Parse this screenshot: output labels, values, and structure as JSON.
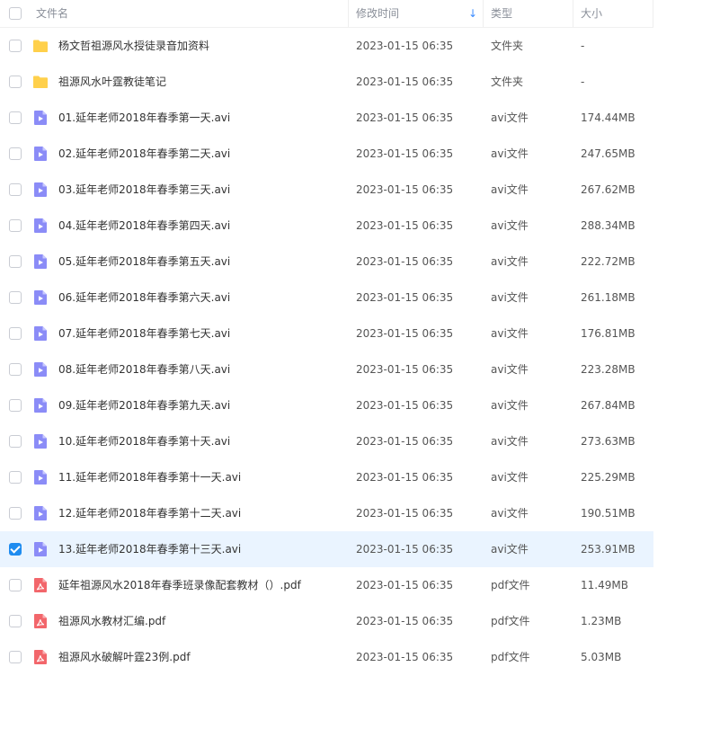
{
  "header": {
    "name_label": "文件名",
    "modified_label": "修改时间",
    "type_label": "类型",
    "size_label": "大小",
    "sort_icon": "sort-down-arrow-icon",
    "sort_glyph": "↓"
  },
  "colors": {
    "folder": "#ffd04b",
    "video": "#8b8cf7",
    "pdf": "#f2666b",
    "checkbox_checked": "#1f8cf0",
    "selected_row": "#eaf4ff"
  },
  "rows": [
    {
      "name": "杨文哲祖源风水授徒录音加资料",
      "modified": "2023-01-15 06:35",
      "type": "文件夹",
      "size": "-",
      "icon": "folder",
      "checked": false
    },
    {
      "name": "祖源风水叶霆教徒笔记",
      "modified": "2023-01-15 06:35",
      "type": "文件夹",
      "size": "-",
      "icon": "folder",
      "checked": false
    },
    {
      "name": "01.延年老师2018年春季第一天.avi",
      "modified": "2023-01-15 06:35",
      "type": "avi文件",
      "size": "174.44MB",
      "icon": "video",
      "checked": false
    },
    {
      "name": "02.延年老师2018年春季第二天.avi",
      "modified": "2023-01-15 06:35",
      "type": "avi文件",
      "size": "247.65MB",
      "icon": "video",
      "checked": false
    },
    {
      "name": "03.延年老师2018年春季第三天.avi",
      "modified": "2023-01-15 06:35",
      "type": "avi文件",
      "size": "267.62MB",
      "icon": "video",
      "checked": false
    },
    {
      "name": "04.延年老师2018年春季第四天.avi",
      "modified": "2023-01-15 06:35",
      "type": "avi文件",
      "size": "288.34MB",
      "icon": "video",
      "checked": false
    },
    {
      "name": "05.延年老师2018年春季第五天.avi",
      "modified": "2023-01-15 06:35",
      "type": "avi文件",
      "size": "222.72MB",
      "icon": "video",
      "checked": false
    },
    {
      "name": "06.延年老师2018年春季第六天.avi",
      "modified": "2023-01-15 06:35",
      "type": "avi文件",
      "size": "261.18MB",
      "icon": "video",
      "checked": false
    },
    {
      "name": "07.延年老师2018年春季第七天.avi",
      "modified": "2023-01-15 06:35",
      "type": "avi文件",
      "size": "176.81MB",
      "icon": "video",
      "checked": false
    },
    {
      "name": "08.延年老师2018年春季第八天.avi",
      "modified": "2023-01-15 06:35",
      "type": "avi文件",
      "size": "223.28MB",
      "icon": "video",
      "checked": false
    },
    {
      "name": "09.延年老师2018年春季第九天.avi",
      "modified": "2023-01-15 06:35",
      "type": "avi文件",
      "size": "267.84MB",
      "icon": "video",
      "checked": false
    },
    {
      "name": "10.延年老师2018年春季第十天.avi",
      "modified": "2023-01-15 06:35",
      "type": "avi文件",
      "size": "273.63MB",
      "icon": "video",
      "checked": false
    },
    {
      "name": "11.延年老师2018年春季第十一天.avi",
      "modified": "2023-01-15 06:35",
      "type": "avi文件",
      "size": "225.29MB",
      "icon": "video",
      "checked": false
    },
    {
      "name": "12.延年老师2018年春季第十二天.avi",
      "modified": "2023-01-15 06:35",
      "type": "avi文件",
      "size": "190.51MB",
      "icon": "video",
      "checked": false
    },
    {
      "name": "13.延年老师2018年春季第十三天.avi",
      "modified": "2023-01-15 06:35",
      "type": "avi文件",
      "size": "253.91MB",
      "icon": "video",
      "checked": true
    },
    {
      "name": "延年祖源风水2018年春季班录像配套教材（）.pdf",
      "modified": "2023-01-15 06:35",
      "type": "pdf文件",
      "size": "11.49MB",
      "icon": "pdf",
      "checked": false
    },
    {
      "name": "祖源风水教材汇编.pdf",
      "modified": "2023-01-15 06:35",
      "type": "pdf文件",
      "size": "1.23MB",
      "icon": "pdf",
      "checked": false
    },
    {
      "name": "祖源风水破解叶霆23例.pdf",
      "modified": "2023-01-15 06:35",
      "type": "pdf文件",
      "size": "5.03MB",
      "icon": "pdf",
      "checked": false
    }
  ]
}
